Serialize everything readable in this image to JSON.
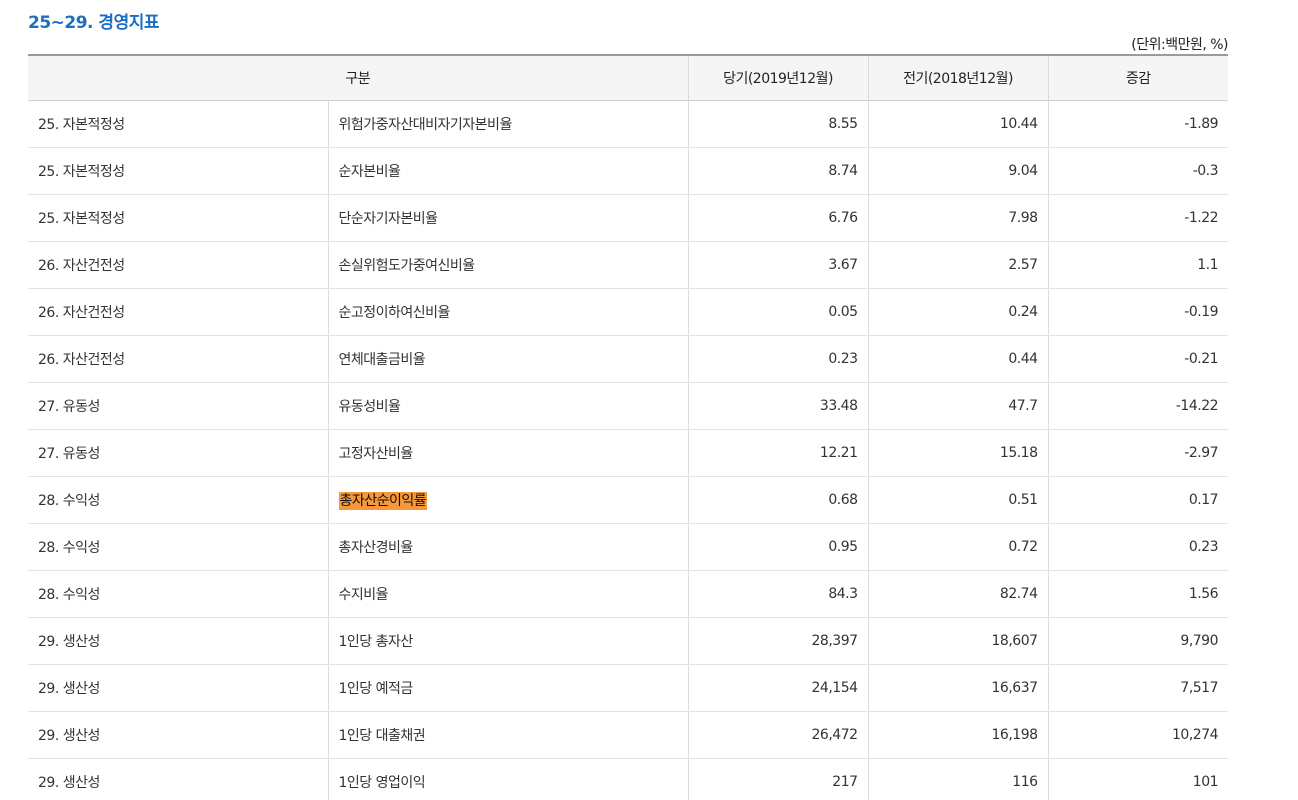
{
  "section": {
    "title": "25~29. 경영지표",
    "unit_note": "(단위:백만원, %)"
  },
  "table": {
    "headers": [
      "구분",
      "당기(2019년12월)",
      "전기(2018년12월)",
      "증감"
    ],
    "rows": [
      {
        "category": "25. 자본적정성",
        "name": "위험가중자산대비자기자본비율",
        "current": "8.55",
        "previous": "10.44",
        "change": "-1.89",
        "highlighted": false
      },
      {
        "category": "25. 자본적정성",
        "name": "순자본비율",
        "current": "8.74",
        "previous": "9.04",
        "change": "-0.3",
        "highlighted": false
      },
      {
        "category": "25. 자본적정성",
        "name": "단순자기자본비율",
        "current": "6.76",
        "previous": "7.98",
        "change": "-1.22",
        "highlighted": false
      },
      {
        "category": "26. 자산건전성",
        "name": "손실위험도가중여신비율",
        "current": "3.67",
        "previous": "2.57",
        "change": "1.1",
        "highlighted": false
      },
      {
        "category": "26. 자산건전성",
        "name": "순고정이하여신비율",
        "current": "0.05",
        "previous": "0.24",
        "change": "-0.19",
        "highlighted": false
      },
      {
        "category": "26. 자산건전성",
        "name": "연체대출금비율",
        "current": "0.23",
        "previous": "0.44",
        "change": "-0.21",
        "highlighted": false
      },
      {
        "category": "27. 유동성",
        "name": "유동성비율",
        "current": "33.48",
        "previous": "47.7",
        "change": "-14.22",
        "highlighted": false
      },
      {
        "category": "27. 유동성",
        "name": "고정자산비율",
        "current": "12.21",
        "previous": "15.18",
        "change": "-2.97",
        "highlighted": false
      },
      {
        "category": "28. 수익성",
        "name": "총자산순이익률",
        "current": "0.68",
        "previous": "0.51",
        "change": "0.17",
        "highlighted": true
      },
      {
        "category": "28. 수익성",
        "name": "총자산경비율",
        "current": "0.95",
        "previous": "0.72",
        "change": "0.23",
        "highlighted": false
      },
      {
        "category": "28. 수익성",
        "name": "수지비율",
        "current": "84.3",
        "previous": "82.74",
        "change": "1.56",
        "highlighted": false
      },
      {
        "category": "29. 생산성",
        "name": "1인당 총자산",
        "current": "28,397",
        "previous": "18,607",
        "change": "9,790",
        "highlighted": false
      },
      {
        "category": "29. 생산성",
        "name": "1인당 예적금",
        "current": "24,154",
        "previous": "16,637",
        "change": "7,517",
        "highlighted": false
      },
      {
        "category": "29. 생산성",
        "name": "1인당 대출채권",
        "current": "26,472",
        "previous": "16,198",
        "change": "10,274",
        "highlighted": false
      },
      {
        "category": "29. 생산성",
        "name": "1인당 영업이익",
        "current": "217",
        "previous": "116",
        "change": "101",
        "highlighted": false
      }
    ]
  },
  "colors": {
    "title": "#1a6fc3",
    "highlight": "#f7983a",
    "header_bg": "#f5f5f5"
  }
}
